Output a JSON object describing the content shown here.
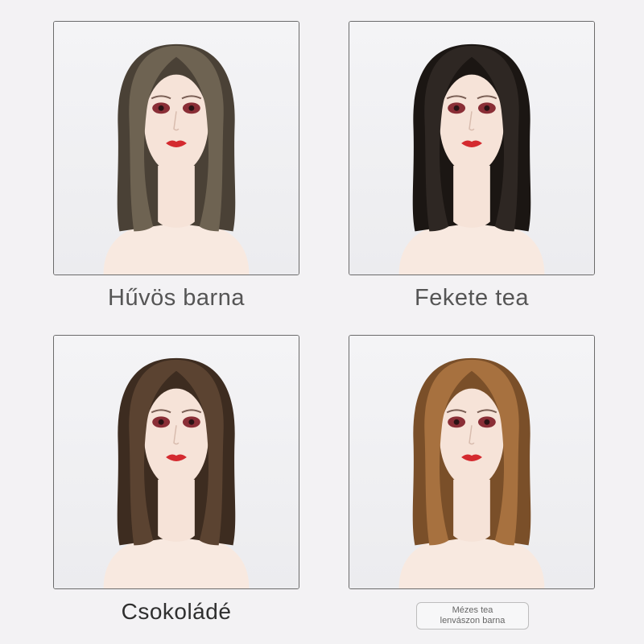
{
  "products": [
    {
      "id": "cool-brown",
      "label": "Hűvös barna",
      "hair_color": "#6e6352",
      "hair_shade": "#4a4136"
    },
    {
      "id": "black-tea",
      "label": "Fekete tea",
      "hair_color": "#2e2723",
      "hair_shade": "#1b1613"
    },
    {
      "id": "chocolate",
      "label": "Csokoládé",
      "hair_color": "#5b4331",
      "hair_shade": "#3d2c20"
    },
    {
      "id": "honey-tea",
      "label_line1": "Mézes tea",
      "label_line2": "lenvászon barna",
      "hair_color": "#a7713f",
      "hair_shade": "#7a4f29"
    }
  ],
  "colors": {
    "background": "#f3f2f4",
    "card_bg": "#ffffff",
    "card_border": "#6b6b6b",
    "skin": "#f6e3d8",
    "lips": "#d42a2f",
    "eyes": "#8a2e36"
  }
}
